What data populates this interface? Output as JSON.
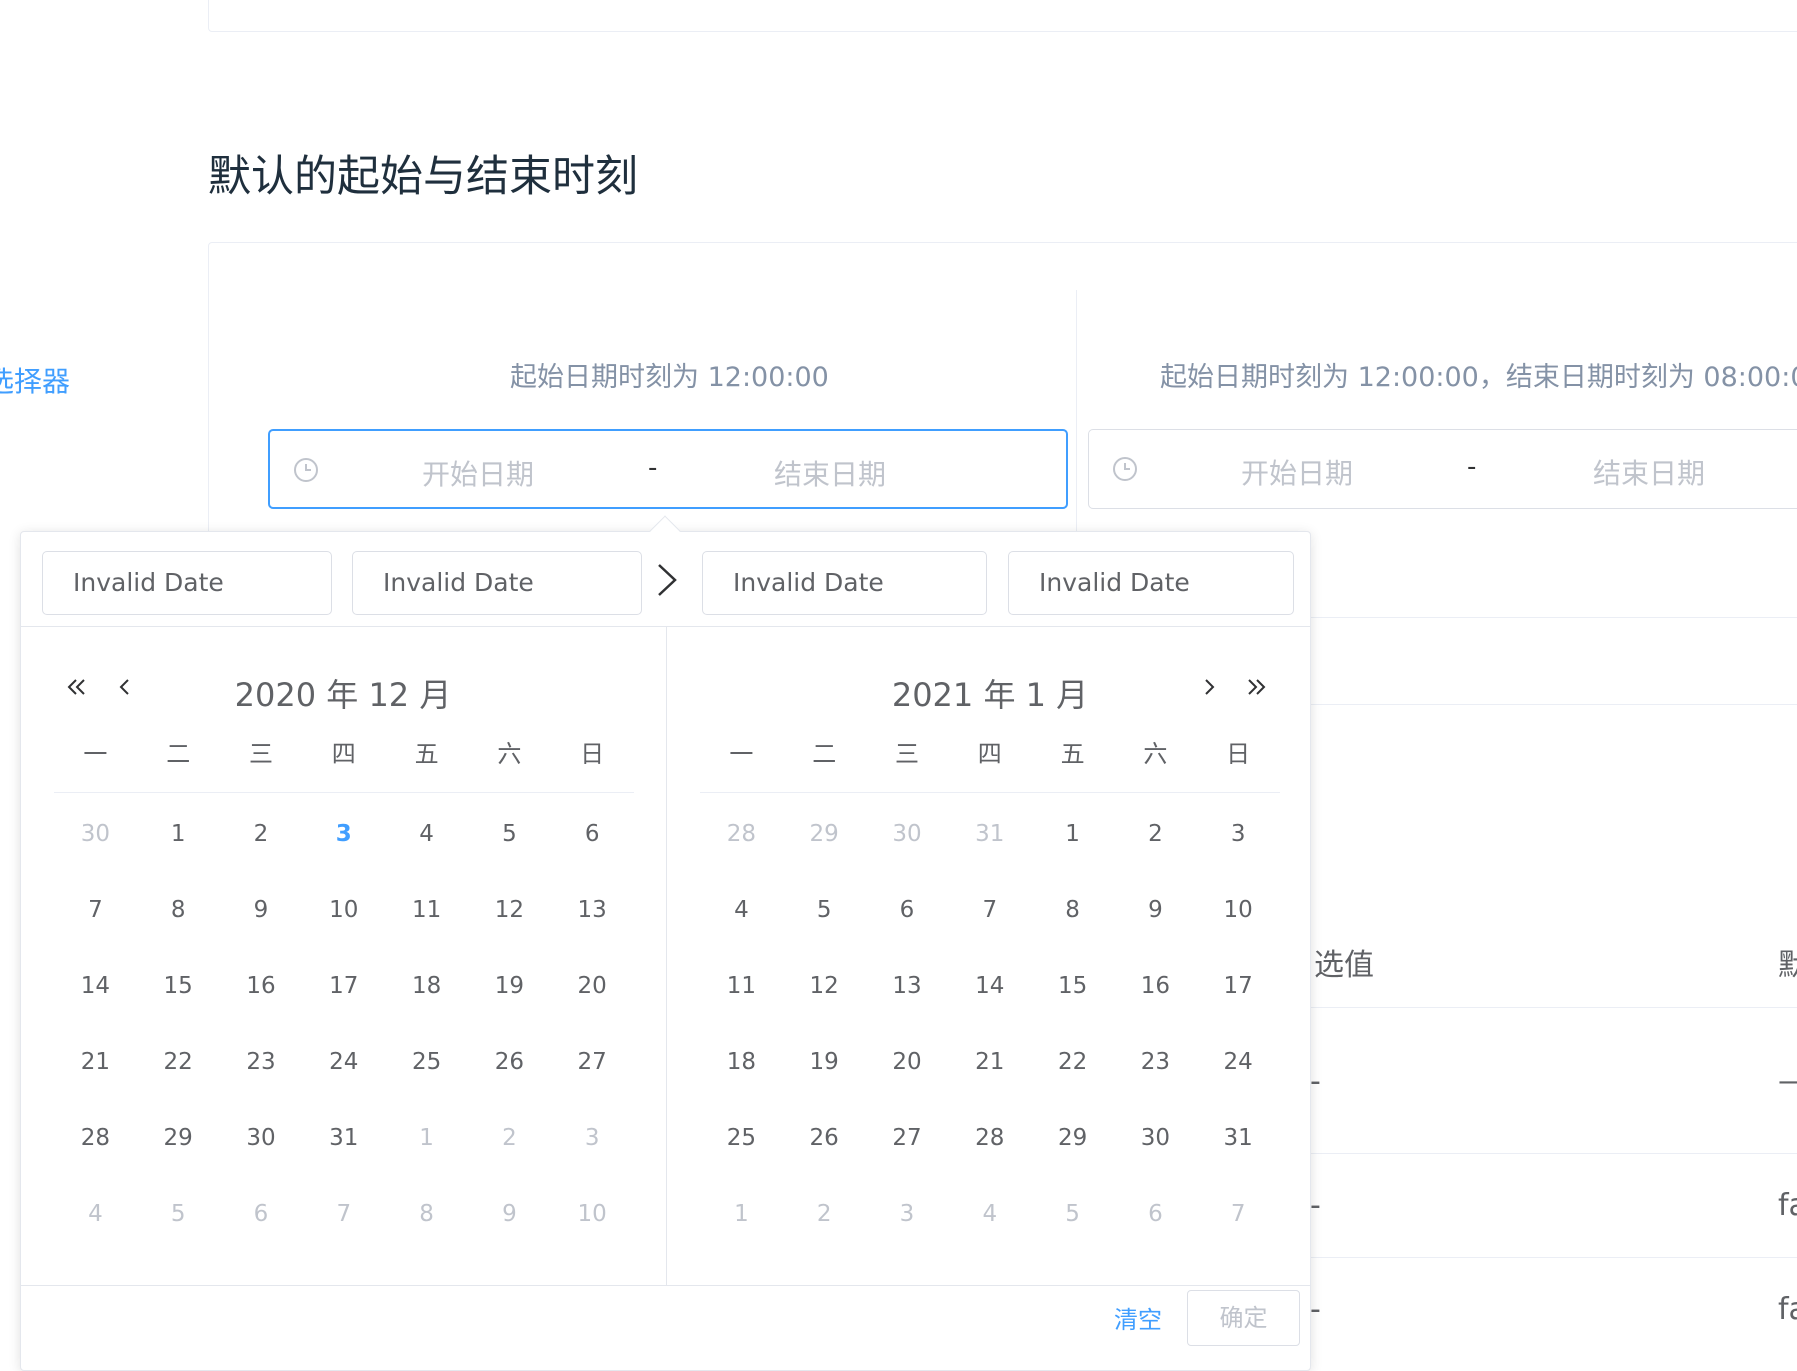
{
  "page": {
    "section_title": "默认的起始与结束时刻",
    "side_link": "选择器"
  },
  "demo_left": {
    "caption": "起始日期时刻为 12:00:00",
    "start_placeholder": "开始日期",
    "separator": "-",
    "end_placeholder": "结束日期"
  },
  "demo_right": {
    "caption": "起始日期时刻为 12:00:00，结束日期时刻为 08:00:0",
    "start_placeholder": "开始日期",
    "separator": "-",
    "end_placeholder": "结束日期"
  },
  "background_table": {
    "header_partial": "选值",
    "header_partial_right": "默",
    "row1_left": "-",
    "row1_right": "—",
    "row2_left": "-",
    "row2_right": "fa",
    "row3_left": "-",
    "row3_right": "fa"
  },
  "picker": {
    "start_date_input": "Invalid Date",
    "start_time_input": "Invalid Date",
    "end_date_input": "Invalid Date",
    "end_time_input": "Invalid Date",
    "weekdays": [
      "一",
      "二",
      "三",
      "四",
      "五",
      "六",
      "日"
    ],
    "left": {
      "title": "2020 年 12 月",
      "days": [
        [
          {
            "d": "30",
            "o": 1
          },
          {
            "d": "1"
          },
          {
            "d": "2"
          },
          {
            "d": "3",
            "t": 1
          },
          {
            "d": "4"
          },
          {
            "d": "5"
          },
          {
            "d": "6"
          }
        ],
        [
          {
            "d": "7"
          },
          {
            "d": "8"
          },
          {
            "d": "9"
          },
          {
            "d": "10"
          },
          {
            "d": "11"
          },
          {
            "d": "12"
          },
          {
            "d": "13"
          }
        ],
        [
          {
            "d": "14"
          },
          {
            "d": "15"
          },
          {
            "d": "16"
          },
          {
            "d": "17"
          },
          {
            "d": "18"
          },
          {
            "d": "19"
          },
          {
            "d": "20"
          }
        ],
        [
          {
            "d": "21"
          },
          {
            "d": "22"
          },
          {
            "d": "23"
          },
          {
            "d": "24"
          },
          {
            "d": "25"
          },
          {
            "d": "26"
          },
          {
            "d": "27"
          }
        ],
        [
          {
            "d": "28"
          },
          {
            "d": "29"
          },
          {
            "d": "30"
          },
          {
            "d": "31"
          },
          {
            "d": "1",
            "o": 1
          },
          {
            "d": "2",
            "o": 1
          },
          {
            "d": "3",
            "o": 1
          }
        ],
        [
          {
            "d": "4",
            "o": 1
          },
          {
            "d": "5",
            "o": 1
          },
          {
            "d": "6",
            "o": 1
          },
          {
            "d": "7",
            "o": 1
          },
          {
            "d": "8",
            "o": 1
          },
          {
            "d": "9",
            "o": 1
          },
          {
            "d": "10",
            "o": 1
          }
        ]
      ]
    },
    "right": {
      "title": "2021 年 1 月",
      "days": [
        [
          {
            "d": "28",
            "o": 1
          },
          {
            "d": "29",
            "o": 1
          },
          {
            "d": "30",
            "o": 1
          },
          {
            "d": "31",
            "o": 1
          },
          {
            "d": "1"
          },
          {
            "d": "2"
          },
          {
            "d": "3"
          }
        ],
        [
          {
            "d": "4"
          },
          {
            "d": "5"
          },
          {
            "d": "6"
          },
          {
            "d": "7"
          },
          {
            "d": "8"
          },
          {
            "d": "9"
          },
          {
            "d": "10"
          }
        ],
        [
          {
            "d": "11"
          },
          {
            "d": "12"
          },
          {
            "d": "13"
          },
          {
            "d": "14"
          },
          {
            "d": "15"
          },
          {
            "d": "16"
          },
          {
            "d": "17"
          }
        ],
        [
          {
            "d": "18"
          },
          {
            "d": "19"
          },
          {
            "d": "20"
          },
          {
            "d": "21"
          },
          {
            "d": "22"
          },
          {
            "d": "23"
          },
          {
            "d": "24"
          }
        ],
        [
          {
            "d": "25"
          },
          {
            "d": "26"
          },
          {
            "d": "27"
          },
          {
            "d": "28"
          },
          {
            "d": "29"
          },
          {
            "d": "30"
          },
          {
            "d": "31"
          }
        ],
        [
          {
            "d": "1",
            "o": 1
          },
          {
            "d": "2",
            "o": 1
          },
          {
            "d": "3",
            "o": 1
          },
          {
            "d": "4",
            "o": 1
          },
          {
            "d": "5",
            "o": 1
          },
          {
            "d": "6",
            "o": 1
          },
          {
            "d": "7",
            "o": 1
          }
        ]
      ]
    },
    "clear_label": "清空",
    "confirm_label": "确定"
  },
  "colors": {
    "accent": "#409eff",
    "text": "#606266",
    "muted": "#c0c4cc",
    "border": "#dcdfe6",
    "title": "#1f2f3d"
  },
  "icons": [
    "clock-icon",
    "chevron-right-icon",
    "double-chevron-left-icon",
    "chevron-left-icon",
    "double-chevron-right-icon"
  ]
}
